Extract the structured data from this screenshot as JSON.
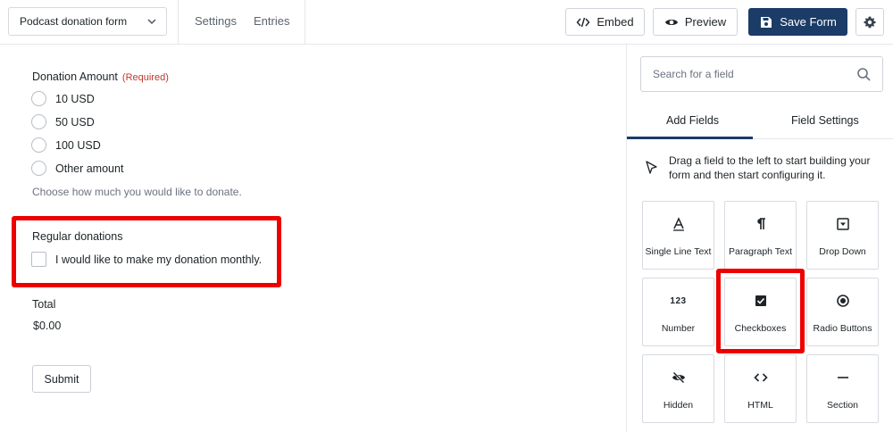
{
  "header": {
    "form_name": "Podcast donation form",
    "nav": {
      "settings": "Settings",
      "entries": "Entries"
    },
    "buttons": {
      "embed": "Embed",
      "preview": "Preview",
      "save": "Save Form"
    }
  },
  "form": {
    "donation": {
      "label": "Donation Amount",
      "required_text": "(Required)",
      "options": [
        "10 USD",
        "50 USD",
        "100 USD",
        "Other amount"
      ],
      "help": "Choose how much you would like to donate."
    },
    "regular": {
      "label": "Regular donations",
      "checkbox_label": "I would like to make my donation monthly."
    },
    "total": {
      "label": "Total",
      "value": "$0.00"
    },
    "submit_label": "Submit"
  },
  "sidebar": {
    "search_placeholder": "Search for a field",
    "tabs": {
      "add": "Add Fields",
      "settings": "Field Settings"
    },
    "hint": "Drag a field to the left to start building your form and then start configuring it.",
    "fields": [
      {
        "label": "Single Line Text",
        "icon": "text-icon"
      },
      {
        "label": "Paragraph Text",
        "icon": "paragraph-icon"
      },
      {
        "label": "Drop Down",
        "icon": "dropdown-icon"
      },
      {
        "label": "Number",
        "icon": "number-icon",
        "icon_text": "123"
      },
      {
        "label": "Checkboxes",
        "icon": "checkbox-icon"
      },
      {
        "label": "Radio Buttons",
        "icon": "radio-icon"
      },
      {
        "label": "Hidden",
        "icon": "eye-off-icon"
      },
      {
        "label": "HTML",
        "icon": "code-icon"
      },
      {
        "label": "Section",
        "icon": "section-icon"
      }
    ]
  },
  "colors": {
    "primary": "#1b3c66",
    "highlight": "#ee0000",
    "required": "#c0392b"
  }
}
